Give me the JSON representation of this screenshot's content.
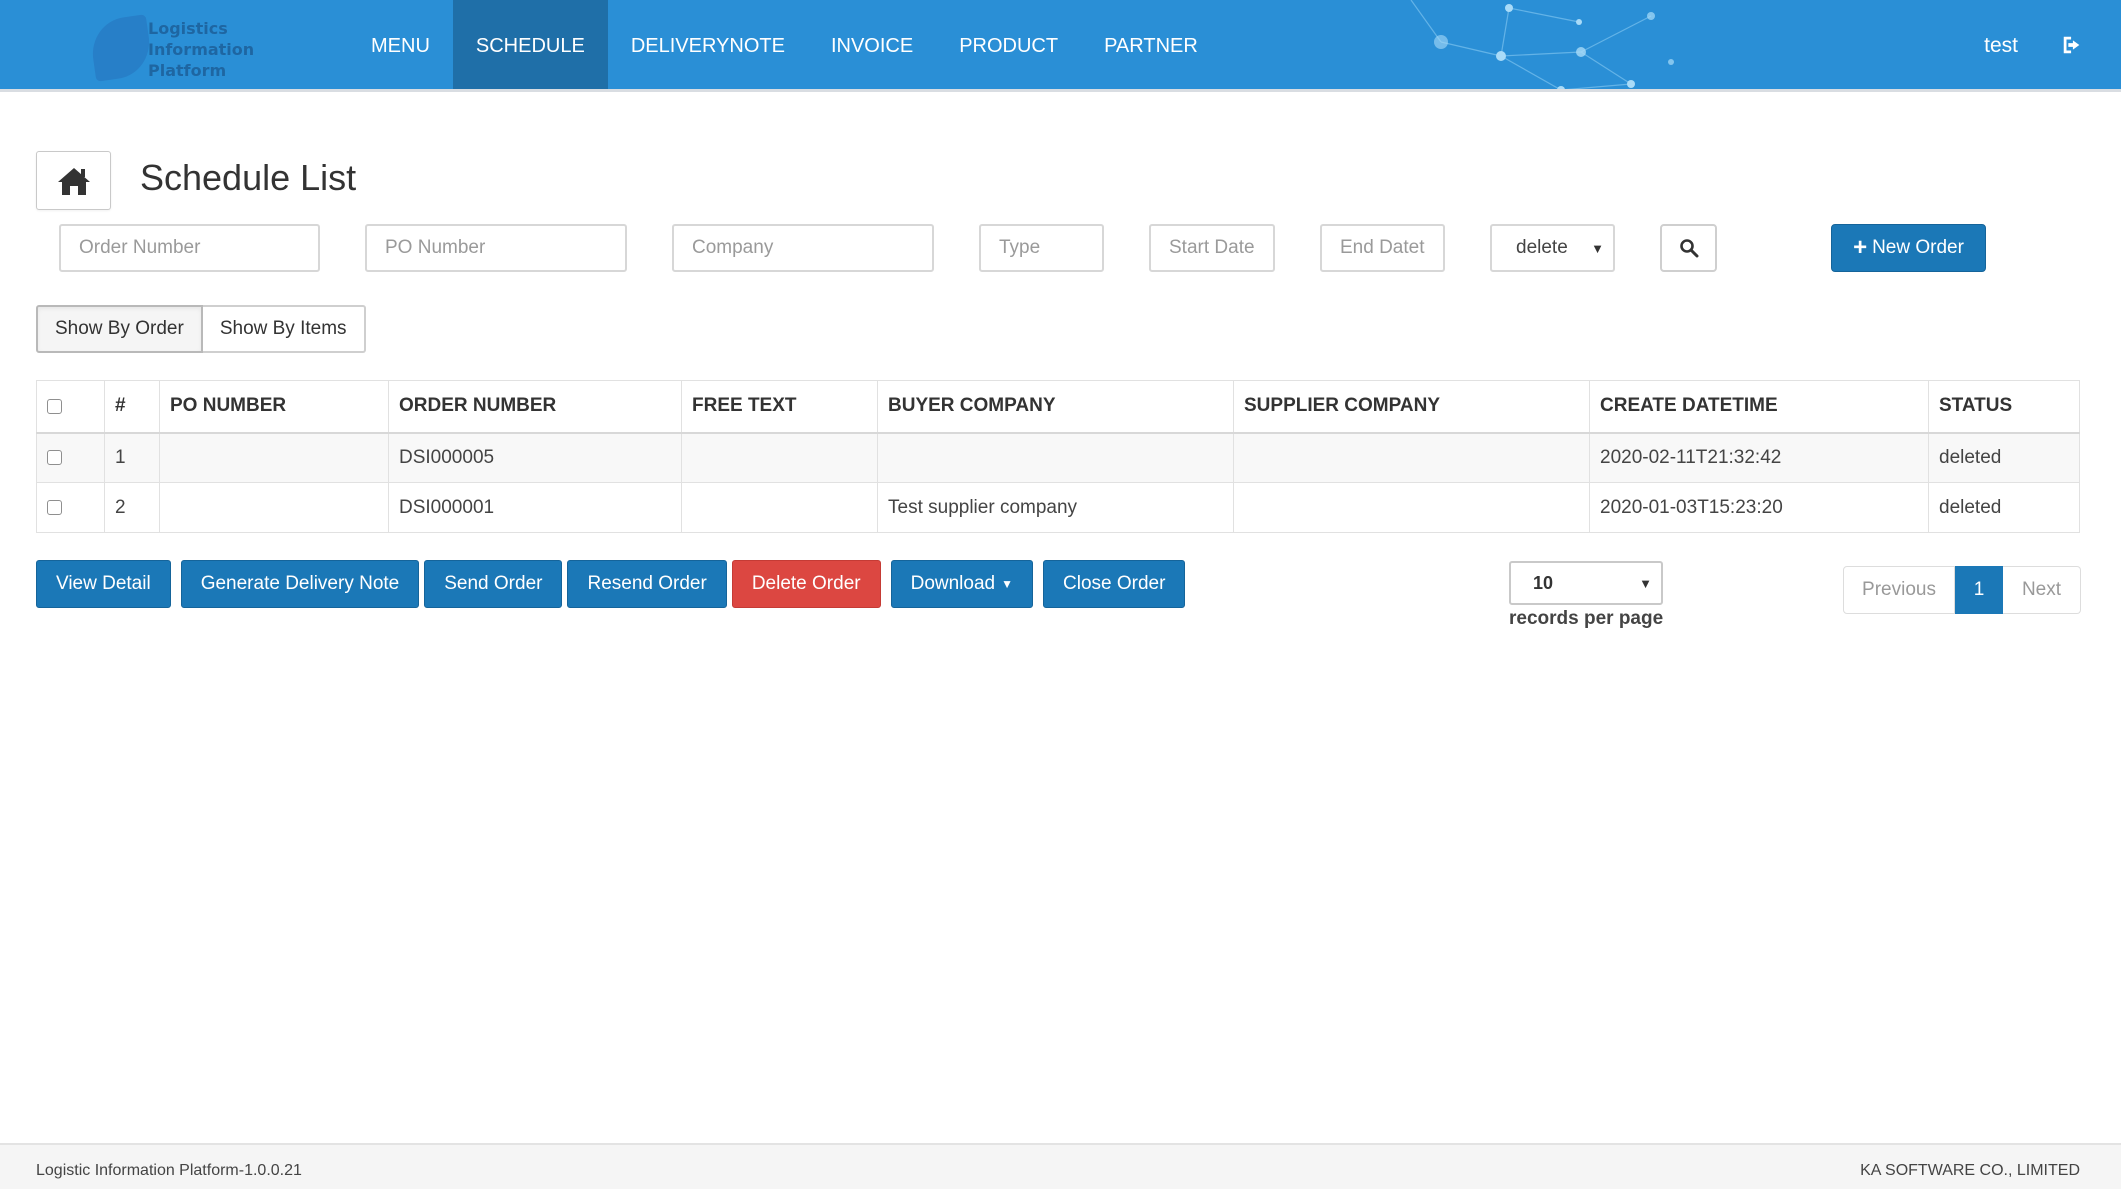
{
  "colors": {
    "navbar": "#2a8fd6",
    "navbar_active": "#1f6fa8",
    "primary_button": "#1b78b7",
    "danger_button": "#dc4741"
  },
  "logo": {
    "line1": "Logistics",
    "line2": "Information",
    "line3": "Platform"
  },
  "nav": {
    "items": [
      {
        "label": "MENU",
        "active": false
      },
      {
        "label": "SCHEDULE",
        "active": true
      },
      {
        "label": "DELIVERYNOTE",
        "active": false
      },
      {
        "label": "INVOICE",
        "active": false
      },
      {
        "label": "PRODUCT",
        "active": false
      },
      {
        "label": "PARTNER",
        "active": false
      }
    ],
    "user": "test",
    "logout_icon": "sign-out-icon"
  },
  "page": {
    "title": "Schedule List",
    "home_icon": "home-icon"
  },
  "filters": {
    "order_number_placeholder": "Order Number",
    "po_number_placeholder": "PO Number",
    "company_placeholder": "Company",
    "type_placeholder": "Type",
    "start_date_placeholder": "Start Date",
    "end_date_placeholder": "End Datet",
    "status_selected": "delete",
    "search_icon": "search-icon",
    "new_order_label": "New Order"
  },
  "view_toggle": {
    "by_order": "Show By Order",
    "by_items": "Show By Items"
  },
  "table": {
    "columns": [
      "#",
      "PO NUMBER",
      "ORDER NUMBER",
      "FREE TEXT",
      "BUYER COMPANY",
      "SUPPLIER COMPANY",
      "CREATE DATETIME",
      "STATUS"
    ],
    "rows": [
      {
        "num": "1",
        "po_number": "",
        "order_number": "DSI000005",
        "free_text": "",
        "buyer_company": "",
        "supplier_company": "",
        "create_datetime": "2020-02-11T21:32:42",
        "status": "deleted"
      },
      {
        "num": "2",
        "po_number": "",
        "order_number": "DSI000001",
        "free_text": "",
        "buyer_company": "Test supplier company",
        "supplier_company": "",
        "create_datetime": "2020-01-03T15:23:20",
        "status": "deleted"
      }
    ]
  },
  "actions": {
    "view_detail": "View Detail",
    "generate_delivery_note": "Generate Delivery Note",
    "send_order": "Send Order",
    "resend_order": "Resend Order",
    "delete_order": "Delete Order",
    "download": "Download",
    "close_order": "Close Order"
  },
  "pager": {
    "per_page_value": "10",
    "per_page_label": "records per page",
    "previous": "Previous",
    "current_page": "1",
    "next": "Next"
  },
  "footer": {
    "version": "Logistic Information Platform-1.0.0.21",
    "company": "KA SOFTWARE CO., LIMITED"
  }
}
